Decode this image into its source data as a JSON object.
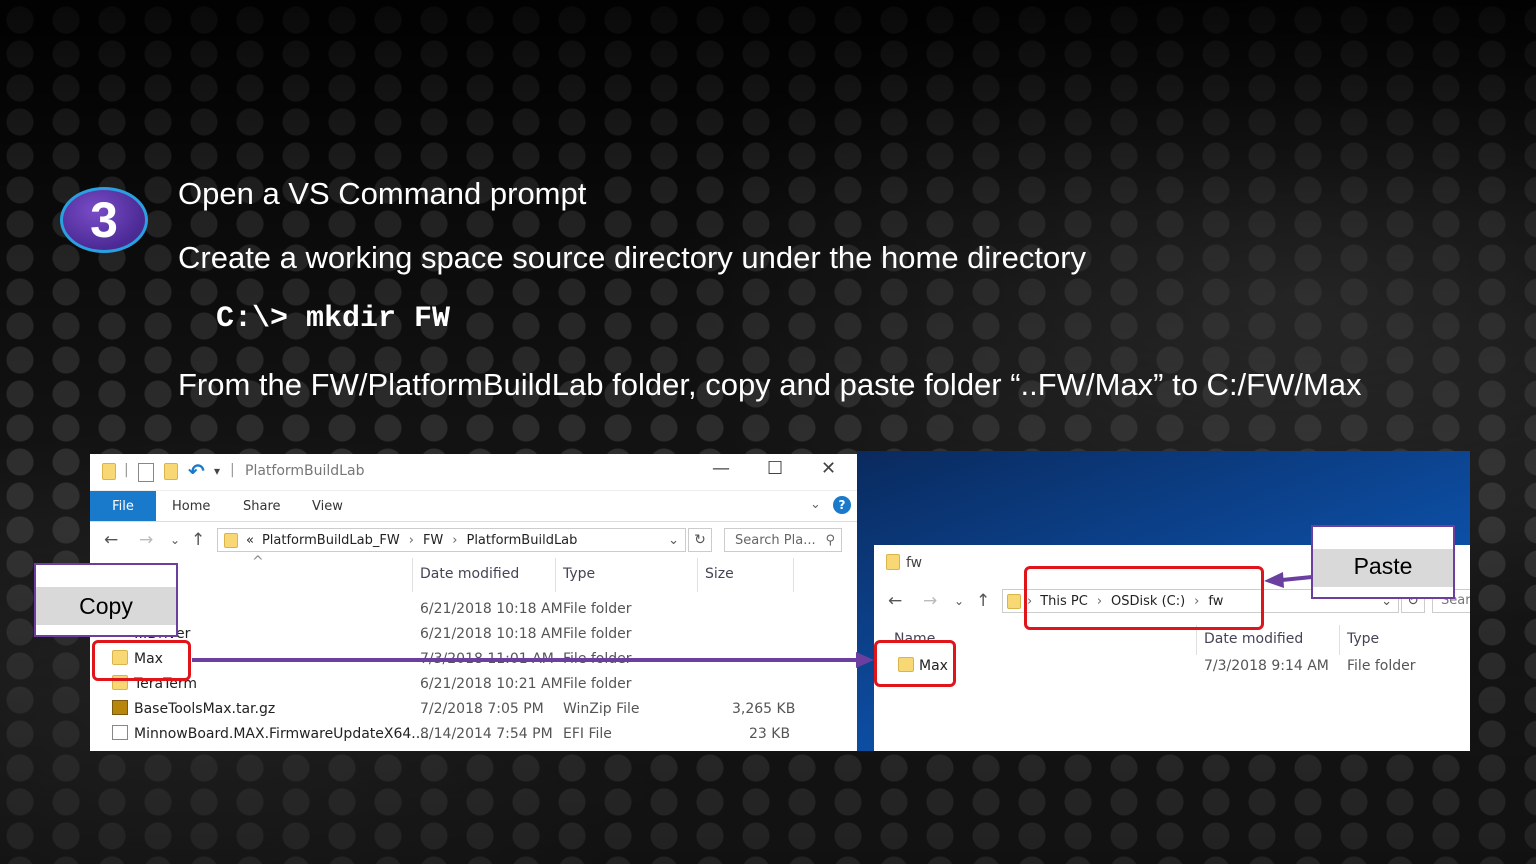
{
  "step_number": "3",
  "lines": {
    "line1": "Open a VS Command prompt",
    "line2": "Create a working  space source directory under the home directory",
    "command": "C:\\> mkdir FW",
    "line4": "From the FW/PlatformBuildLab folder, copy and paste folder “..FW/Max” to C:/FW/Max"
  },
  "left_explorer": {
    "title": "PlatformBuildLab",
    "ribbon_tabs": [
      "File",
      "Home",
      "Share",
      "View"
    ],
    "breadcrumb": [
      "«",
      "PlatformBuildLab_FW",
      "FW",
      "PlatformBuildLab"
    ],
    "search_placeholder": "Search Pla...",
    "columns": [
      "Date modified",
      "Type",
      "Size"
    ],
    "rows": [
      {
        "name": "",
        "date": "6/21/2018 10:18 AM",
        "type": "File folder",
        "size": ""
      },
      {
        "name": "...Driver",
        "date": "6/21/2018 10:18 AM",
        "type": "File folder",
        "size": ""
      },
      {
        "name": "Max",
        "date": "7/3/2018 11:01 AM",
        "type": "File folder",
        "size": ""
      },
      {
        "name": "TeraTerm",
        "date": "6/21/2018 10:21 AM",
        "type": "File folder",
        "size": ""
      },
      {
        "name": "BaseToolsMax.tar.gz",
        "date": "7/2/2018 7:05 PM",
        "type": "WinZip File",
        "size": "3,265 KB"
      },
      {
        "name": "MinnowBoard.MAX.FirmwareUpdateX64....",
        "date": "8/14/2014 7:54 PM",
        "type": "EFI File",
        "size": "23 KB"
      }
    ]
  },
  "right_explorer": {
    "title": "fw",
    "breadcrumb": [
      "This PC",
      "OSDisk (C:)",
      "fw"
    ],
    "search_placeholder": "Sear",
    "columns": [
      "Name",
      "Date modified",
      "Type"
    ],
    "rows": [
      {
        "name": "Max",
        "date": "7/3/2018 9:14 AM",
        "type": "File folder"
      }
    ]
  },
  "callouts": {
    "copy": "Copy",
    "paste": "Paste"
  },
  "colors": {
    "accent_purple": "#6b3fa0",
    "highlight_red": "#e0151b",
    "badge_border": "#2aa0e0",
    "ribbon_blue": "#1979ca"
  }
}
